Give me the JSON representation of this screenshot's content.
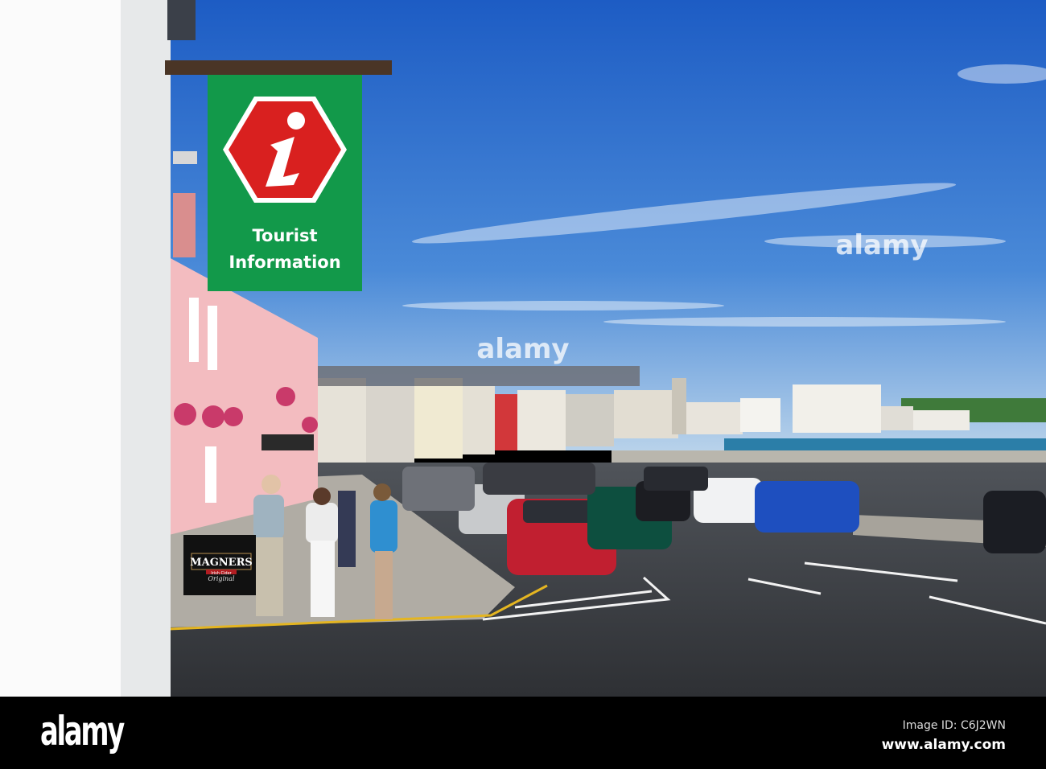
{
  "sign": {
    "line1": "Tourist",
    "line2": "Information",
    "icon": "info-i-icon"
  },
  "banner": {
    "brand": "MAGNERS",
    "sub": "Irish Cider",
    "tag": "Original"
  },
  "watermark": "alamy",
  "footer": {
    "logo": "alamy",
    "image_id": "Image ID: C6J2WN",
    "url": "www.alamy.com"
  },
  "colors": {
    "sign_green": "#12994a",
    "sign_red": "#d9201f",
    "sky": "#2a6fd0"
  }
}
